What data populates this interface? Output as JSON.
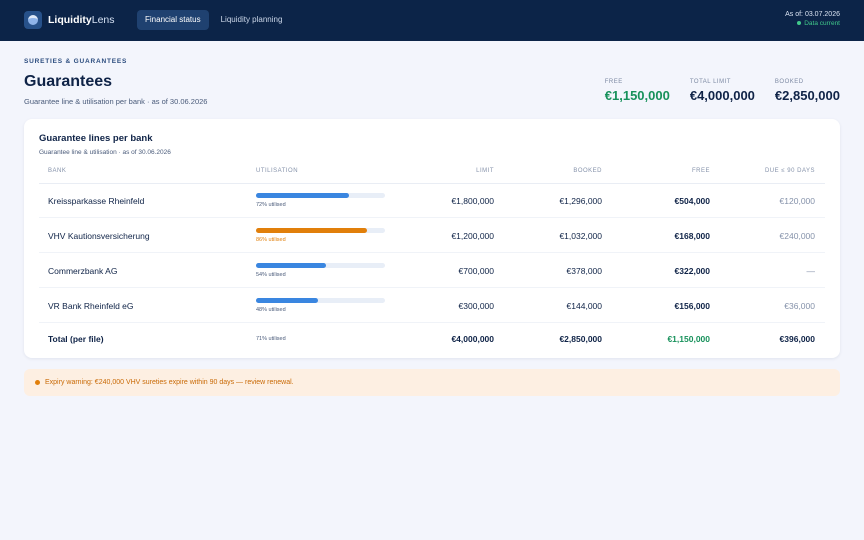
{
  "app": {
    "name_bold": "Liquidity",
    "name_light": "Lens"
  },
  "nav": {
    "tabs": [
      {
        "label": "Financial status",
        "active": true
      },
      {
        "label": "Liquidity planning",
        "active": false
      }
    ]
  },
  "status": {
    "as_of": "As of: 03.07.2026",
    "live": "Data current"
  },
  "page": {
    "eyebrow": "SURETIES & GUARANTEES",
    "title": "Guarantees",
    "subtitle": "Guarantee line & utilisation per bank · as of 30.06.2026"
  },
  "kpis": [
    {
      "label": "FREE",
      "value": "€1,150,000",
      "color": "#17915b"
    },
    {
      "label": "TOTAL LIMIT",
      "value": "€4,000,000"
    },
    {
      "label": "BOOKED",
      "value": "€2,850,000"
    }
  ],
  "card": {
    "title": "Guarantee lines per bank",
    "subtitle": "Guarantee line & utilisation · as of 30.06.2026",
    "columns": {
      "bank": "BANK",
      "utilisation": "UTILISATION",
      "limit": "LIMIT",
      "booked": "BOOKED",
      "free": "FREE",
      "due": "DUE ≤ 90 DAYS"
    },
    "rows": [
      {
        "bank": "Kreissparkasse Rheinfeld",
        "utilisation_pct": 72,
        "utilisation_label": "72% utilised",
        "bar_color": "#3a86e0",
        "warn": false,
        "limit": "€1,800,000",
        "booked": "€1,296,000",
        "free": "€504,000",
        "due": "€120,000"
      },
      {
        "bank": "VHV Kautionsversicherung",
        "utilisation_pct": 86,
        "utilisation_label": "86% utilised",
        "bar_color": "#e17f0a",
        "warn": true,
        "limit": "€1,200,000",
        "booked": "€1,032,000",
        "free": "€168,000",
        "due": "€240,000"
      },
      {
        "bank": "Commerzbank AG",
        "utilisation_pct": 54,
        "utilisation_label": "54% utilised",
        "bar_color": "#3a86e0",
        "warn": false,
        "limit": "€700,000",
        "booked": "€378,000",
        "free": "€322,000",
        "due": "—"
      },
      {
        "bank": "VR Bank Rheinfeld eG",
        "utilisation_pct": 48,
        "utilisation_label": "48% utilised",
        "bar_color": "#3a86e0",
        "warn": false,
        "limit": "€300,000",
        "booked": "€144,000",
        "free": "€156,000",
        "due": "€36,000"
      }
    ],
    "total": {
      "bank": "Total (per file)",
      "utilisation_label": "71% utilised",
      "limit": "€4,000,000",
      "booked": "€2,850,000",
      "free": "€1,150,000",
      "due": "€396,000"
    }
  },
  "alert": {
    "text": "Expiry warning: €240,000 VHV sureties expire within 90 days — review renewal.",
    "color": "#e17f0a"
  }
}
